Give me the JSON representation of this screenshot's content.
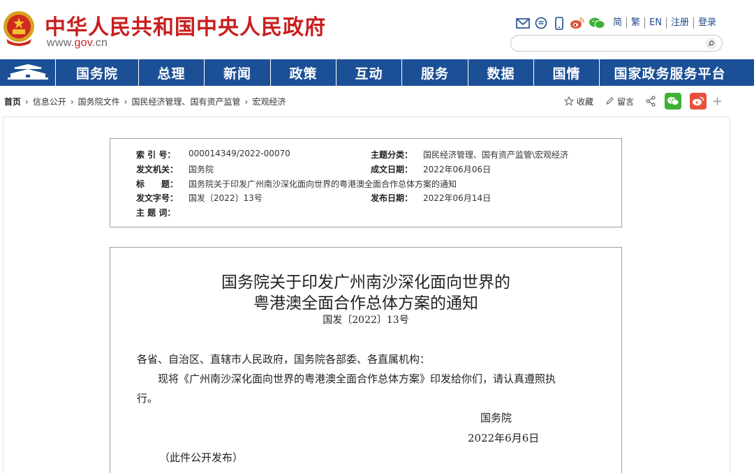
{
  "header": {
    "site_title": "中华人民共和国中央人民政府",
    "domain_prefix": "www.",
    "domain_gov": "gov",
    "domain_suffix": ".cn",
    "languages": [
      "简",
      "繁",
      "EN"
    ],
    "register": "注册",
    "login": "登录",
    "search_placeholder": "",
    "icons": [
      "mail-icon",
      "message-icon",
      "mobile-icon",
      "weibo-icon",
      "wechat-icon"
    ]
  },
  "nav": {
    "items": [
      "国务院",
      "总理",
      "新闻",
      "政策",
      "互动",
      "服务",
      "数据",
      "国情",
      "国家政务服务平台"
    ]
  },
  "breadcrumb": {
    "home": "首页",
    "items": [
      "信息公开",
      "国务院文件",
      "国民经济管理、国有资产监管",
      "宏观经济"
    ]
  },
  "actions": {
    "favorite": "收藏",
    "comment": "留言"
  },
  "meta": {
    "index_no_label": "索 引 号：",
    "index_no": "000014349/2022-00070",
    "category_label": "主题分类：",
    "category": "国民经济管理、国有资产监管\\宏观经济",
    "issuer_label": "发文机关：",
    "issuer": "国务院",
    "written_date_label": "成文日期：",
    "written_date": "2022年06月06日",
    "title_label": "标　　题：",
    "title": "国务院关于印发广州南沙深化面向世界的粤港澳全面合作总体方案的通知",
    "doc_no_label": "发文字号：",
    "doc_no": "国发〔2022〕13号",
    "publish_date_label": "发布日期：",
    "publish_date": "2022年06月14日",
    "keywords_label": "主 题 词："
  },
  "document": {
    "title_line1": "国务院关于印发广州南沙深化面向世界的",
    "title_line2": "粤港澳全面合作总体方案的通知",
    "doc_no": "国发〔2022〕13号",
    "salutation": "各省、自治区、直辖市人民政府，国务院各部委、各直属机构：",
    "body_line1": "现将《广州南沙深化面向世界的粤港澳全面合作总体方案》印发给你们，请认真遵照执",
    "body_line2": "行。",
    "signer": "国务院",
    "sign_date": "2022年6月6日",
    "note": "（此件公开发布）"
  },
  "colors": {
    "brand_red": "#c81e1e",
    "nav_blue": "#1c5096",
    "link_blue": "#1c4a88",
    "wechat_green": "#3eb135",
    "weibo_red": "#e8503a"
  }
}
